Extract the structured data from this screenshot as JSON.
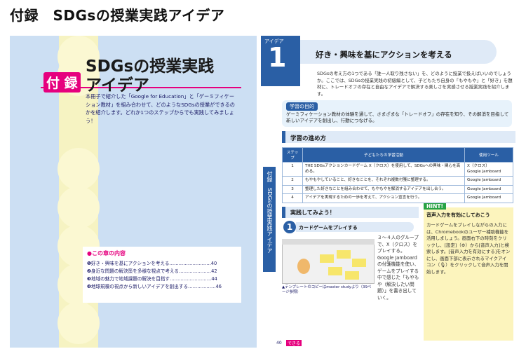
{
  "page_title": "付録　SDGsの授業実践アイデア",
  "left": {
    "badge": "付 録",
    "heading_line1": "SDGsの授業実践",
    "heading_line2": "アイデア",
    "intro": "本冊子で紹介した「Google for Education」と「ゲーミフィケーション教材」を組み合わせて、どのようなSDGsの授業ができるのかを紹介します。どれか1つのステップからでも実践してみましょう！",
    "toc_heading": "●この章の内容",
    "toc": [
      "❶好き・興味を基にアクションを考える………………………40",
      "❷身近な問題の解決策を多様な視点で考える…………………42",
      "❸地域の魅力で地域課題の解決を目指す………………………44",
      "❹地球規模の視点から新しいアイデアを創出する………………46"
    ]
  },
  "right": {
    "idea_label": "アイデア",
    "idea_number": "1",
    "heading": "好き・興味を基にアクションを考える",
    "paragraph": "SDGsの考え方の1つである「誰一人取り残さない」を、どのように授業で扱えばいいのでしょうか。ここでは、SDGsの授業実践の初級編として、子どもたち自身の「もやもや」と「好き」を題材に、トレードオフの存在と自由なアイデアで解決する楽しさを実感させる授業実践を紹介します。",
    "goal_tag": "学習の目的",
    "goal_text": "ゲーミフィケーション教材の体験を通して、さまざまな「トレードオフ」の存在を知り、その解消を目指して新しいアイデアを創出し、行動につなげる。",
    "section_process": "学習の進め方",
    "table_headers": [
      "ステップ",
      "子どもたちの学習活動",
      "使用ツール"
    ],
    "table_rows": [
      {
        "step": "1",
        "activity": "THE SDGsアクションカードゲーム X（クロス）を使用して、SDGsへの興味・関心を高める。",
        "tool": "X（クロス）\nGoogle Jamboard"
      },
      {
        "step": "2",
        "activity": "もやもやしていること、好きなことを、それぞれ複数付箋に整理する。",
        "tool": "Google Jamboard"
      },
      {
        "step": "3",
        "activity": "整理した好きなことを組み合わせて、もやもやを解消するアイデアを出し合う。",
        "tool": "Google Jamboard"
      },
      {
        "step": "4",
        "activity": "アイデアを実現するための一歩を考えて、アクション宣言を行う。",
        "tool": "Google Jamboard"
      }
    ],
    "side_label": "付録　SDGsの授業実践アイデア",
    "section_try": "実践してみよう！",
    "step_number": "1",
    "step_title": "カードゲームをプレイする",
    "step_text": "３〜４人のグループで、X（クロス）をプレイする。Google Jamboardの付箋機能を使い、ゲームをプレイする中で感じた「もやもや（解決したい問題）」を書き出していく。",
    "caption": "▲テンプレートのコピーはmaster studyより（39ページ参照）",
    "hint_tag": "HINT!",
    "hint_title": "音声入力を有効にしておこう",
    "hint_text": "カードゲームをプレイしながらの入力には、Chromebookのユーザー補助機能を活用しましょう。画面右下の時刻をクリックし、[設定]（⚙）から[音声入力]と検索します。[音声入力を有効にする]をオンにし、画面下部に表示されるマイクアイコン（🎙）をクリックして音声入力を開始します。",
    "page_number": "40",
    "page_tag": "できる"
  }
}
